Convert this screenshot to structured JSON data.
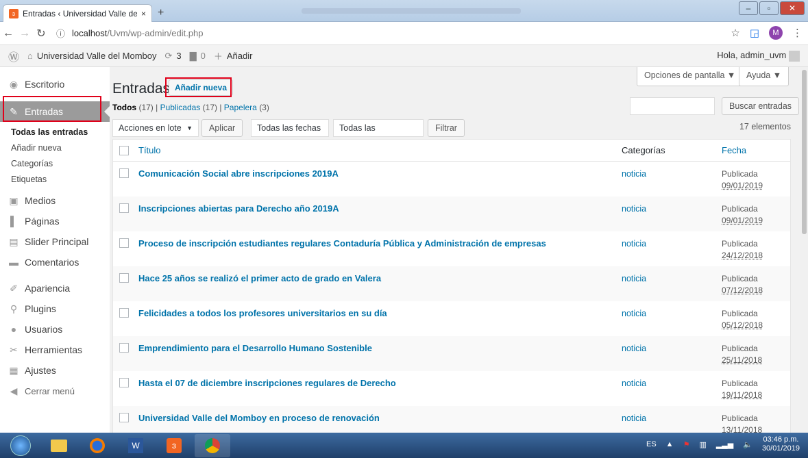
{
  "browser": {
    "tab_title": "Entradas ‹ Universidad Valle del M",
    "tab_close": "×",
    "new_tab": "+",
    "url_host": "localhost",
    "url_path": "/Uvm/wp-admin/edit.php",
    "profile_initial": "M"
  },
  "admin_bar": {
    "site_name": "Universidad Valle del Momboy",
    "updates_count": "3",
    "comments_count": "0",
    "add_label": "Añadir",
    "greeting": "Hola, admin_uvm"
  },
  "sidebar": {
    "items": [
      {
        "label": "Escritorio",
        "icon": "dashboard-icon"
      },
      {
        "label": "Entradas",
        "icon": "pin-icon"
      },
      {
        "label": "Medios",
        "icon": "media-icon"
      },
      {
        "label": "Páginas",
        "icon": "page-icon"
      },
      {
        "label": "Slider Principal",
        "icon": "slider-icon"
      },
      {
        "label": "Comentarios",
        "icon": "comment-icon"
      },
      {
        "label": "Apariencia",
        "icon": "brush-icon"
      },
      {
        "label": "Plugins",
        "icon": "plugin-icon"
      },
      {
        "label": "Usuarios",
        "icon": "users-icon"
      },
      {
        "label": "Herramientas",
        "icon": "wrench-icon"
      },
      {
        "label": "Ajustes",
        "icon": "settings-icon"
      },
      {
        "label": "Cerrar menú",
        "icon": "collapse-icon"
      }
    ],
    "submenu": [
      "Todas las entradas",
      "Añadir nueva",
      "Categorías",
      "Etiquetas"
    ]
  },
  "main": {
    "title": "Entradas",
    "add_new": "Añadir nueva",
    "screen_options": "Opciones de pantalla ▼",
    "help": "Ayuda ▼",
    "filter_all": "Todos",
    "filter_all_count": "(17)",
    "filter_published": "Publicadas",
    "filter_published_count": "(17)",
    "filter_trash": "Papelera",
    "filter_trash_count": "(3)",
    "search_button": "Buscar entradas",
    "bulk_actions": "Acciones en lote",
    "apply": "Aplicar",
    "all_dates": "Todas las fechas",
    "all_categories": "Todas las categorías",
    "filter": "Filtrar",
    "items_count": "17 elementos",
    "columns": {
      "title": "Título",
      "categories": "Categorías",
      "date": "Fecha"
    },
    "rows": [
      {
        "title": "Comunicación Social abre inscripciones 2019A",
        "category": "noticia",
        "status": "Publicada",
        "date": "09/01/2019"
      },
      {
        "title": "Inscripciones abiertas para Derecho año 2019A",
        "category": "noticia",
        "status": "Publicada",
        "date": "09/01/2019"
      },
      {
        "title": "Proceso de inscripción estudiantes regulares Contaduría Pública y Administración de empresas",
        "category": "noticia",
        "status": "Publicada",
        "date": "24/12/2018"
      },
      {
        "title": "Hace 25 años se realizó el primer acto de grado en Valera",
        "category": "noticia",
        "status": "Publicada",
        "date": "07/12/2018"
      },
      {
        "title": "Felicidades a todos los profesores universitarios en su día",
        "category": "noticia",
        "status": "Publicada",
        "date": "05/12/2018"
      },
      {
        "title": "Emprendimiento para el Desarrollo Humano Sostenible",
        "category": "noticia",
        "status": "Publicada",
        "date": "25/11/2018"
      },
      {
        "title": "Hasta el 07 de diciembre inscripciones regulares de Derecho",
        "category": "noticia",
        "status": "Publicada",
        "date": "19/11/2018"
      },
      {
        "title": "Universidad Valle del Momboy en proceso de renovación",
        "category": "noticia",
        "status": "Publicada",
        "date": "13/11/2018"
      }
    ]
  },
  "taskbar": {
    "lang": "ES",
    "time": "03:46 p.m.",
    "date": "30/01/2019"
  }
}
